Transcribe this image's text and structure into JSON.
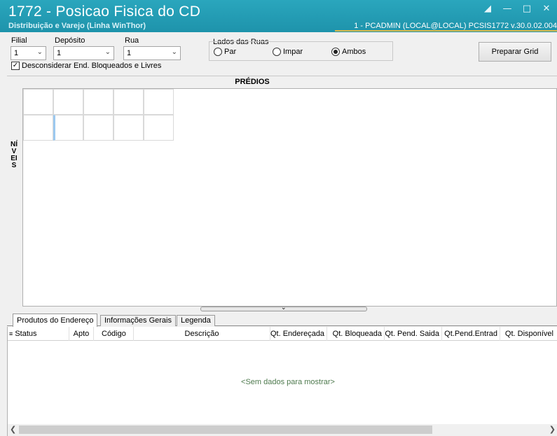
{
  "window": {
    "title": "1772 - Posicao Fisica do CD",
    "subtitle": "Distribuição e Varejo (Linha WinThor)",
    "connection": "1 - PCADMIN (LOCAL@LOCAL)   PCSIS1772  v.30.0.02.004",
    "accent_color": "#1e93ab"
  },
  "filters": {
    "filial_label": "Filial",
    "filial_value": "1",
    "deposito_label": "Depósito",
    "deposito_value": "1",
    "rua_label": "Rua",
    "rua_value": "1",
    "lados_label": "Lados das Ruas",
    "lado_par": "Par",
    "lado_impar": "Impar",
    "lado_ambos": "Ambos",
    "lado_selected": "Ambos",
    "desconsiderar_label": "Desconsiderar End. Bloqueados e Livres",
    "desconsiderar_checked": true,
    "preparar_button": "Preparar Grid"
  },
  "grid": {
    "predios_label": "PRÉDIOS",
    "niveis_label": "NÍVEIS"
  },
  "tabs": [
    {
      "label": "Produtos do Endereço",
      "active": true
    },
    {
      "label": "Informações Gerais",
      "active": false
    },
    {
      "label": "Legenda",
      "active": false
    }
  ],
  "table": {
    "columns": [
      "Status",
      "Apto",
      "Código",
      "Descrição",
      "Qt. Endereçada",
      "Qt. Bloqueada",
      "Qt. Pend. Saida",
      "Qt.Pend.Entrad",
      "Qt. Disponível"
    ],
    "empty_message": "<Sem dados para mostrar>"
  }
}
